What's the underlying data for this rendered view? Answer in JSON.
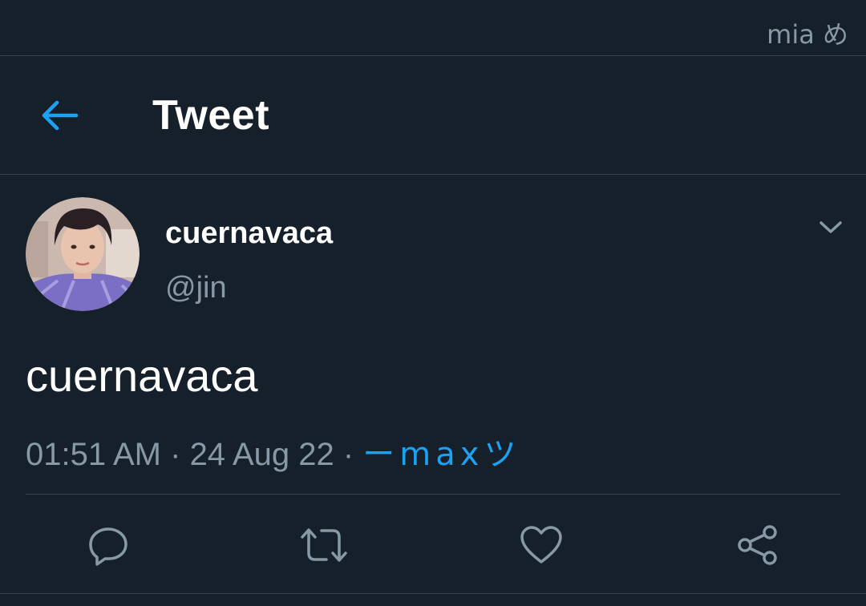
{
  "status_bar": {
    "text": "mia め"
  },
  "header": {
    "title": "Tweet",
    "back_icon": "arrow-left-icon"
  },
  "tweet": {
    "display_name": "cuernavaca",
    "handle": "@jin",
    "text": "cuernavaca",
    "time": "01:51 AM",
    "separator": " · ",
    "date": "24 Aug 22",
    "source": "ーmaxツ",
    "avatar_icon": "profile-photo",
    "more_icon": "chevron-down-icon"
  },
  "actions": [
    {
      "name": "reply",
      "icon": "reply-icon"
    },
    {
      "name": "retweet",
      "icon": "retweet-icon"
    },
    {
      "name": "like",
      "icon": "heart-icon"
    },
    {
      "name": "share",
      "icon": "share-icon"
    }
  ],
  "colors": {
    "background": "#15202b",
    "accent": "#1da1f2",
    "secondary_text": "#8899a6",
    "border": "#38444d",
    "primary_text": "#ffffff"
  }
}
